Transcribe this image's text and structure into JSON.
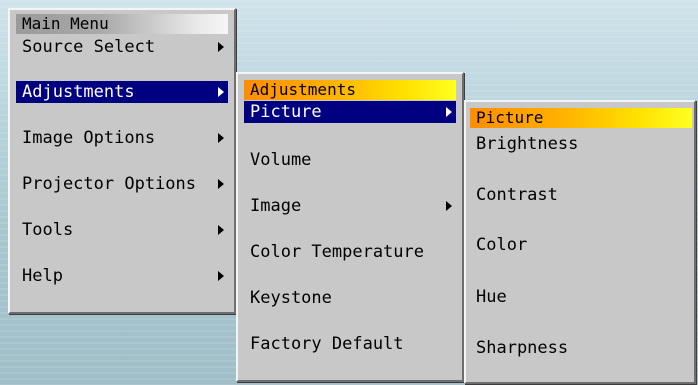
{
  "main_menu": {
    "title": "Main Menu",
    "items": [
      {
        "label": "Source Select",
        "has_submenu": true
      },
      {
        "label": "Adjustments",
        "has_submenu": true,
        "selected": true
      },
      {
        "label": "Image Options",
        "has_submenu": true
      },
      {
        "label": "Projector Options",
        "has_submenu": true
      },
      {
        "label": "Tools",
        "has_submenu": true
      },
      {
        "label": "Help",
        "has_submenu": true
      }
    ]
  },
  "adjustments_menu": {
    "title": "Adjustments",
    "items": [
      {
        "label": "Picture",
        "has_submenu": true,
        "selected": true
      },
      {
        "label": "Volume"
      },
      {
        "label": "Image",
        "has_submenu": true
      },
      {
        "label": "Color Temperature"
      },
      {
        "label": "Keystone"
      },
      {
        "label": "Factory Default"
      }
    ]
  },
  "picture_menu": {
    "title": "Picture",
    "items": [
      {
        "label": "Brightness"
      },
      {
        "label": "Contrast"
      },
      {
        "label": "Color"
      },
      {
        "label": "Hue"
      },
      {
        "label": "Sharpness"
      }
    ]
  },
  "colors": {
    "selection": "#000080",
    "panel": "#c8c8c8",
    "title_accent": "#ff8c00"
  }
}
